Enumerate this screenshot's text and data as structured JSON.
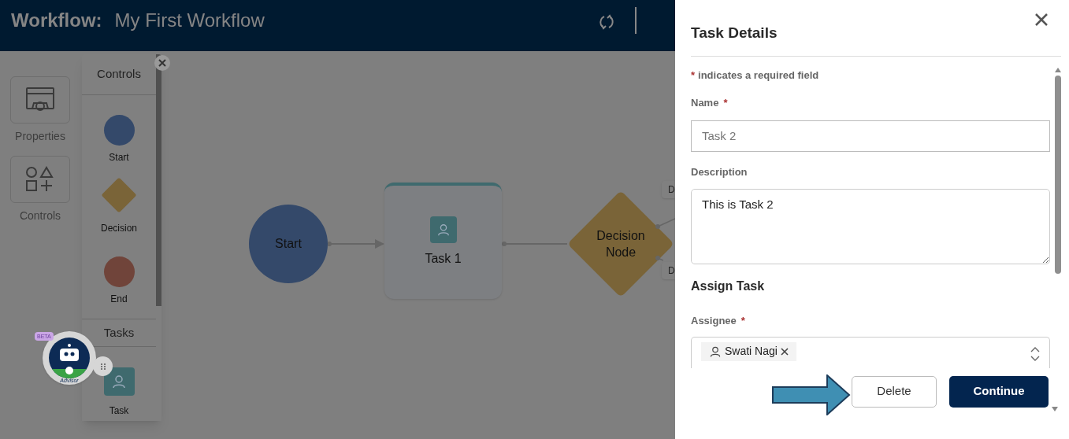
{
  "header": {
    "label": "Workflow:",
    "title": "My First Workflow"
  },
  "rail": [
    {
      "kind": "properties",
      "label": "Properties"
    },
    {
      "kind": "controls",
      "label": "Controls"
    }
  ],
  "palette": {
    "title": "Controls",
    "items": [
      {
        "kind": "start",
        "label": "Start"
      },
      {
        "kind": "decision",
        "label": "Decision"
      },
      {
        "kind": "end",
        "label": "End"
      }
    ],
    "tasks_title": "Tasks",
    "task_items": [
      {
        "label": "Task"
      }
    ]
  },
  "advisor": {
    "badge": "BETA",
    "label": "Advisor"
  },
  "canvas": {
    "nodes": [
      {
        "kind": "start",
        "label": "Start"
      },
      {
        "kind": "task",
        "label": "Task 1"
      },
      {
        "kind": "decision",
        "label": "Decision Node"
      }
    ],
    "edge_labels": [
      "D",
      "D"
    ]
  },
  "panel": {
    "title": "Task Details",
    "required_mark": "*",
    "required_note": "indicates a required field",
    "fields": [
      {
        "kind": "input",
        "label": "Name",
        "required": true,
        "value": "Task 2"
      },
      {
        "kind": "textarea",
        "label": "Description",
        "required": false,
        "value": "This is Task 2"
      }
    ],
    "section": "Assign Task",
    "assignee": {
      "label": "Assignee",
      "required": true,
      "chips": [
        "Swati Nagi"
      ]
    },
    "buttons": [
      {
        "kind": "secondary",
        "label": "Delete"
      },
      {
        "kind": "primary",
        "label": "Continue"
      }
    ]
  }
}
